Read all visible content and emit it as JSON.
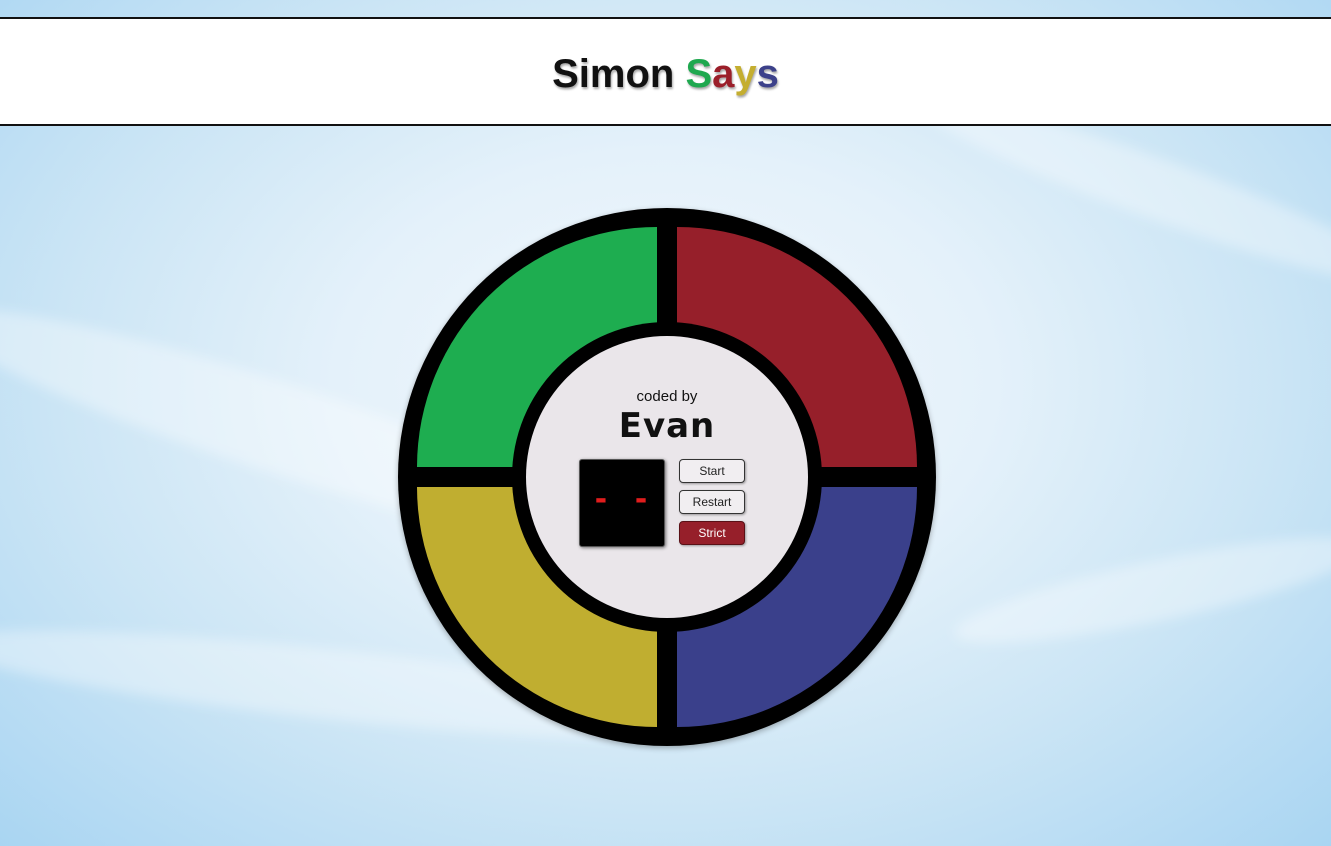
{
  "header": {
    "title_part1": "Simon",
    "title_part2": [
      "S",
      "a",
      "y",
      "s"
    ]
  },
  "game": {
    "pads": [
      {
        "name": "green",
        "color": "#1ead50"
      },
      {
        "name": "red",
        "color": "#961f2a"
      },
      {
        "name": "yellow",
        "color": "#c0ae30"
      },
      {
        "name": "blue",
        "color": "#3a408b"
      }
    ],
    "credit_label": "coded by",
    "author": "Evan",
    "display_value": "- -",
    "buttons": {
      "start": "Start",
      "restart": "Restart",
      "strict": "Strict"
    }
  },
  "colors": {
    "display_text": "#e11d1d",
    "strict_button": "#961f2a"
  }
}
